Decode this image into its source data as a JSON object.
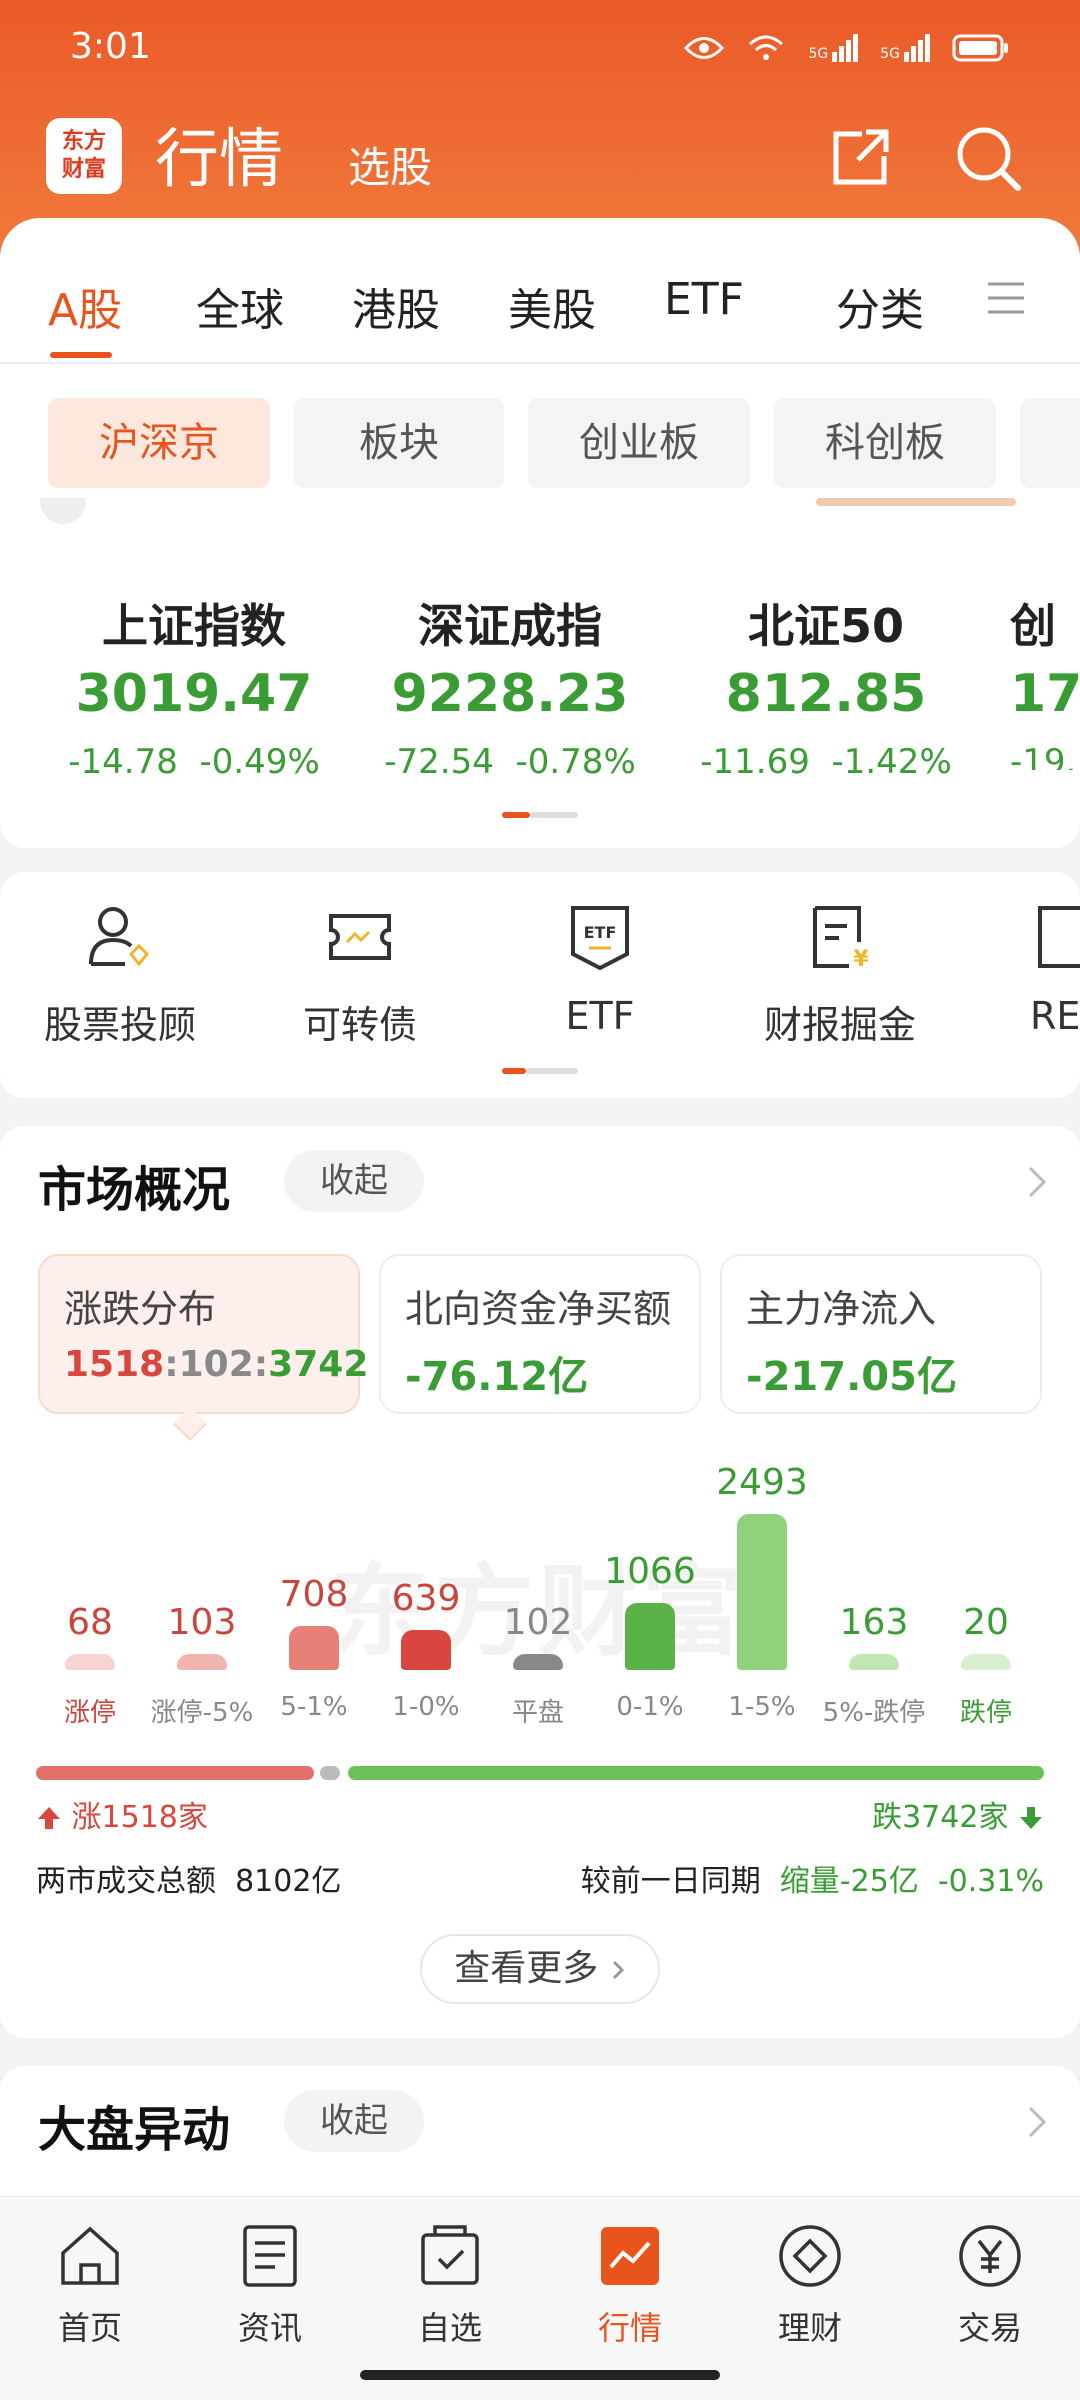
{
  "status": {
    "time": "3:01",
    "net1": "5G",
    "net2": "5G"
  },
  "header": {
    "logo": "东方财富",
    "title": "行情",
    "subtitle": "选股"
  },
  "tabs": [
    "A股",
    "全球",
    "港股",
    "美股",
    "ETF",
    "分类"
  ],
  "chips": [
    "沪深京",
    "板块",
    "创业板",
    "科创板"
  ],
  "indices": [
    {
      "name": "上证指数",
      "value": "3019.47",
      "change": "-14.78",
      "pct": "-0.49%"
    },
    {
      "name": "深证成指",
      "value": "9228.23",
      "change": "-72.54",
      "pct": "-0.78%"
    },
    {
      "name": "北证50",
      "value": "812.85",
      "change": "-11.69",
      "pct": "-1.42%"
    },
    {
      "name": "创",
      "value": "17",
      "change": "-19.",
      "pct": ""
    }
  ],
  "tools": [
    "股票投顾",
    "可转债",
    "ETF",
    "财报掘金",
    "RE"
  ],
  "market": {
    "title": "市场概况",
    "collapse": "收起",
    "stats": [
      {
        "title": "涨跌分布",
        "up": "1518",
        "sep1": ":",
        "flat": "102",
        "sep2": ":",
        "down": "3742"
      },
      {
        "title": "北向资金净买额",
        "value": "-76.12亿"
      },
      {
        "title": "主力净流入",
        "value": "-217.05亿"
      }
    ],
    "watermark": "东方财富",
    "dist": [
      {
        "label": "涨停",
        "count": 68,
        "color": "#f7d4d0",
        "text": "#c9463d"
      },
      {
        "label": "涨停-5%",
        "count": 103,
        "color": "#f2b5ad",
        "text": "#c9463d"
      },
      {
        "label": "5-1%",
        "count": 708,
        "color": "#e78077",
        "text": "#c9463d"
      },
      {
        "label": "1-0%",
        "count": 639,
        "color": "#d9463e",
        "text": "#c9463d"
      },
      {
        "label": "平盘",
        "count": 102,
        "color": "#888888",
        "text": "#888888"
      },
      {
        "label": "0-1%",
        "count": 1066,
        "color": "#5bb247",
        "text": "#3a9c35"
      },
      {
        "label": "1-5%",
        "count": 2493,
        "color": "#8ed27b",
        "text": "#3a9c35"
      },
      {
        "label": "5%-跌停",
        "count": 163,
        "color": "#bfe6b3",
        "text": "#3a9c35"
      },
      {
        "label": "跌停",
        "count": 20,
        "color": "#d8f0d0",
        "text": "#3a9c35"
      }
    ],
    "up_text": "涨1518家",
    "down_text": "跌3742家",
    "turnover_label": "两市成交总额",
    "turnover_value": "8102亿",
    "compare_label": "较前一日同期",
    "compare_value": "缩量-25亿",
    "compare_pct": "-0.31%",
    "more": "查看更多",
    "colors": {
      "up": "#d9463e",
      "down": "#3a9c35",
      "accent": "#e9541d"
    }
  },
  "abnormal": {
    "title": "大盘异动",
    "collapse": "收起"
  },
  "nav": [
    "首页",
    "资讯",
    "自选",
    "行情",
    "理财",
    "交易"
  ]
}
